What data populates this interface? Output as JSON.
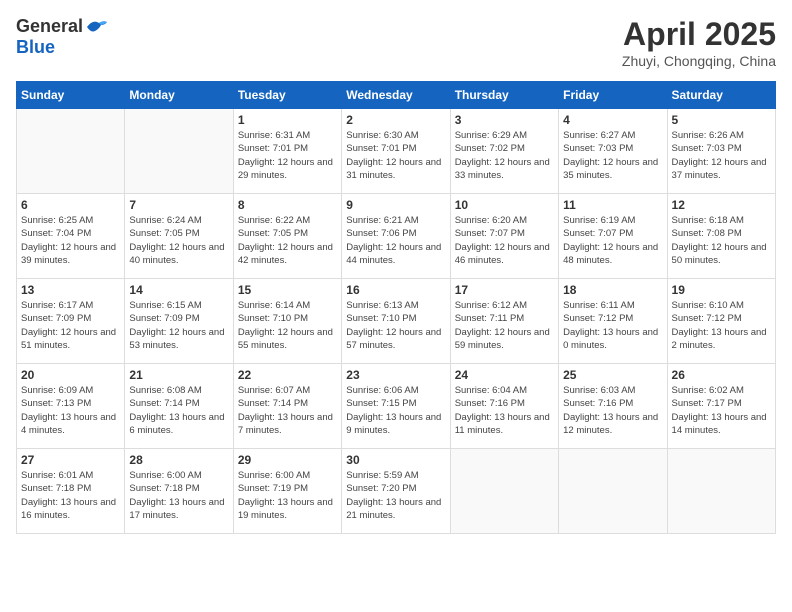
{
  "logo": {
    "general": "General",
    "blue": "Blue"
  },
  "header": {
    "month": "April 2025",
    "location": "Zhuyi, Chongqing, China"
  },
  "weekdays": [
    "Sunday",
    "Monday",
    "Tuesday",
    "Wednesday",
    "Thursday",
    "Friday",
    "Saturday"
  ],
  "weeks": [
    [
      {
        "day": null
      },
      {
        "day": null
      },
      {
        "day": "1",
        "sunrise": "Sunrise: 6:31 AM",
        "sunset": "Sunset: 7:01 PM",
        "daylight": "Daylight: 12 hours and 29 minutes."
      },
      {
        "day": "2",
        "sunrise": "Sunrise: 6:30 AM",
        "sunset": "Sunset: 7:01 PM",
        "daylight": "Daylight: 12 hours and 31 minutes."
      },
      {
        "day": "3",
        "sunrise": "Sunrise: 6:29 AM",
        "sunset": "Sunset: 7:02 PM",
        "daylight": "Daylight: 12 hours and 33 minutes."
      },
      {
        "day": "4",
        "sunrise": "Sunrise: 6:27 AM",
        "sunset": "Sunset: 7:03 PM",
        "daylight": "Daylight: 12 hours and 35 minutes."
      },
      {
        "day": "5",
        "sunrise": "Sunrise: 6:26 AM",
        "sunset": "Sunset: 7:03 PM",
        "daylight": "Daylight: 12 hours and 37 minutes."
      }
    ],
    [
      {
        "day": "6",
        "sunrise": "Sunrise: 6:25 AM",
        "sunset": "Sunset: 7:04 PM",
        "daylight": "Daylight: 12 hours and 39 minutes."
      },
      {
        "day": "7",
        "sunrise": "Sunrise: 6:24 AM",
        "sunset": "Sunset: 7:05 PM",
        "daylight": "Daylight: 12 hours and 40 minutes."
      },
      {
        "day": "8",
        "sunrise": "Sunrise: 6:22 AM",
        "sunset": "Sunset: 7:05 PM",
        "daylight": "Daylight: 12 hours and 42 minutes."
      },
      {
        "day": "9",
        "sunrise": "Sunrise: 6:21 AM",
        "sunset": "Sunset: 7:06 PM",
        "daylight": "Daylight: 12 hours and 44 minutes."
      },
      {
        "day": "10",
        "sunrise": "Sunrise: 6:20 AM",
        "sunset": "Sunset: 7:07 PM",
        "daylight": "Daylight: 12 hours and 46 minutes."
      },
      {
        "day": "11",
        "sunrise": "Sunrise: 6:19 AM",
        "sunset": "Sunset: 7:07 PM",
        "daylight": "Daylight: 12 hours and 48 minutes."
      },
      {
        "day": "12",
        "sunrise": "Sunrise: 6:18 AM",
        "sunset": "Sunset: 7:08 PM",
        "daylight": "Daylight: 12 hours and 50 minutes."
      }
    ],
    [
      {
        "day": "13",
        "sunrise": "Sunrise: 6:17 AM",
        "sunset": "Sunset: 7:09 PM",
        "daylight": "Daylight: 12 hours and 51 minutes."
      },
      {
        "day": "14",
        "sunrise": "Sunrise: 6:15 AM",
        "sunset": "Sunset: 7:09 PM",
        "daylight": "Daylight: 12 hours and 53 minutes."
      },
      {
        "day": "15",
        "sunrise": "Sunrise: 6:14 AM",
        "sunset": "Sunset: 7:10 PM",
        "daylight": "Daylight: 12 hours and 55 minutes."
      },
      {
        "day": "16",
        "sunrise": "Sunrise: 6:13 AM",
        "sunset": "Sunset: 7:10 PM",
        "daylight": "Daylight: 12 hours and 57 minutes."
      },
      {
        "day": "17",
        "sunrise": "Sunrise: 6:12 AM",
        "sunset": "Sunset: 7:11 PM",
        "daylight": "Daylight: 12 hours and 59 minutes."
      },
      {
        "day": "18",
        "sunrise": "Sunrise: 6:11 AM",
        "sunset": "Sunset: 7:12 PM",
        "daylight": "Daylight: 13 hours and 0 minutes."
      },
      {
        "day": "19",
        "sunrise": "Sunrise: 6:10 AM",
        "sunset": "Sunset: 7:12 PM",
        "daylight": "Daylight: 13 hours and 2 minutes."
      }
    ],
    [
      {
        "day": "20",
        "sunrise": "Sunrise: 6:09 AM",
        "sunset": "Sunset: 7:13 PM",
        "daylight": "Daylight: 13 hours and 4 minutes."
      },
      {
        "day": "21",
        "sunrise": "Sunrise: 6:08 AM",
        "sunset": "Sunset: 7:14 PM",
        "daylight": "Daylight: 13 hours and 6 minutes."
      },
      {
        "day": "22",
        "sunrise": "Sunrise: 6:07 AM",
        "sunset": "Sunset: 7:14 PM",
        "daylight": "Daylight: 13 hours and 7 minutes."
      },
      {
        "day": "23",
        "sunrise": "Sunrise: 6:06 AM",
        "sunset": "Sunset: 7:15 PM",
        "daylight": "Daylight: 13 hours and 9 minutes."
      },
      {
        "day": "24",
        "sunrise": "Sunrise: 6:04 AM",
        "sunset": "Sunset: 7:16 PM",
        "daylight": "Daylight: 13 hours and 11 minutes."
      },
      {
        "day": "25",
        "sunrise": "Sunrise: 6:03 AM",
        "sunset": "Sunset: 7:16 PM",
        "daylight": "Daylight: 13 hours and 12 minutes."
      },
      {
        "day": "26",
        "sunrise": "Sunrise: 6:02 AM",
        "sunset": "Sunset: 7:17 PM",
        "daylight": "Daylight: 13 hours and 14 minutes."
      }
    ],
    [
      {
        "day": "27",
        "sunrise": "Sunrise: 6:01 AM",
        "sunset": "Sunset: 7:18 PM",
        "daylight": "Daylight: 13 hours and 16 minutes."
      },
      {
        "day": "28",
        "sunrise": "Sunrise: 6:00 AM",
        "sunset": "Sunset: 7:18 PM",
        "daylight": "Daylight: 13 hours and 17 minutes."
      },
      {
        "day": "29",
        "sunrise": "Sunrise: 6:00 AM",
        "sunset": "Sunset: 7:19 PM",
        "daylight": "Daylight: 13 hours and 19 minutes."
      },
      {
        "day": "30",
        "sunrise": "Sunrise: 5:59 AM",
        "sunset": "Sunset: 7:20 PM",
        "daylight": "Daylight: 13 hours and 21 minutes."
      },
      {
        "day": null
      },
      {
        "day": null
      },
      {
        "day": null
      }
    ]
  ]
}
